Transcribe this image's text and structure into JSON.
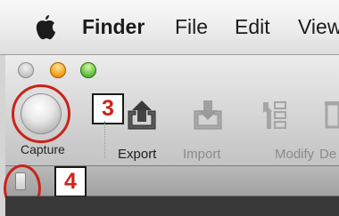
{
  "menubar": {
    "app": "Finder",
    "items": [
      "File",
      "Edit",
      "View"
    ]
  },
  "toolbar": {
    "capture_label": "Capture",
    "tools": [
      {
        "label": "Export",
        "enabled": true,
        "icon": "export-icon"
      },
      {
        "label": "Import",
        "enabled": false,
        "icon": "import-icon"
      },
      {
        "label": "Modify",
        "enabled": false,
        "icon": "modify-icon"
      },
      {
        "label": "De",
        "enabled": false,
        "icon": "delete-icon"
      }
    ]
  },
  "annotations": {
    "capture_step": "3",
    "device_step": "4"
  },
  "colors": {
    "highlight": "#c9231b",
    "badge_text": "#d32018"
  }
}
